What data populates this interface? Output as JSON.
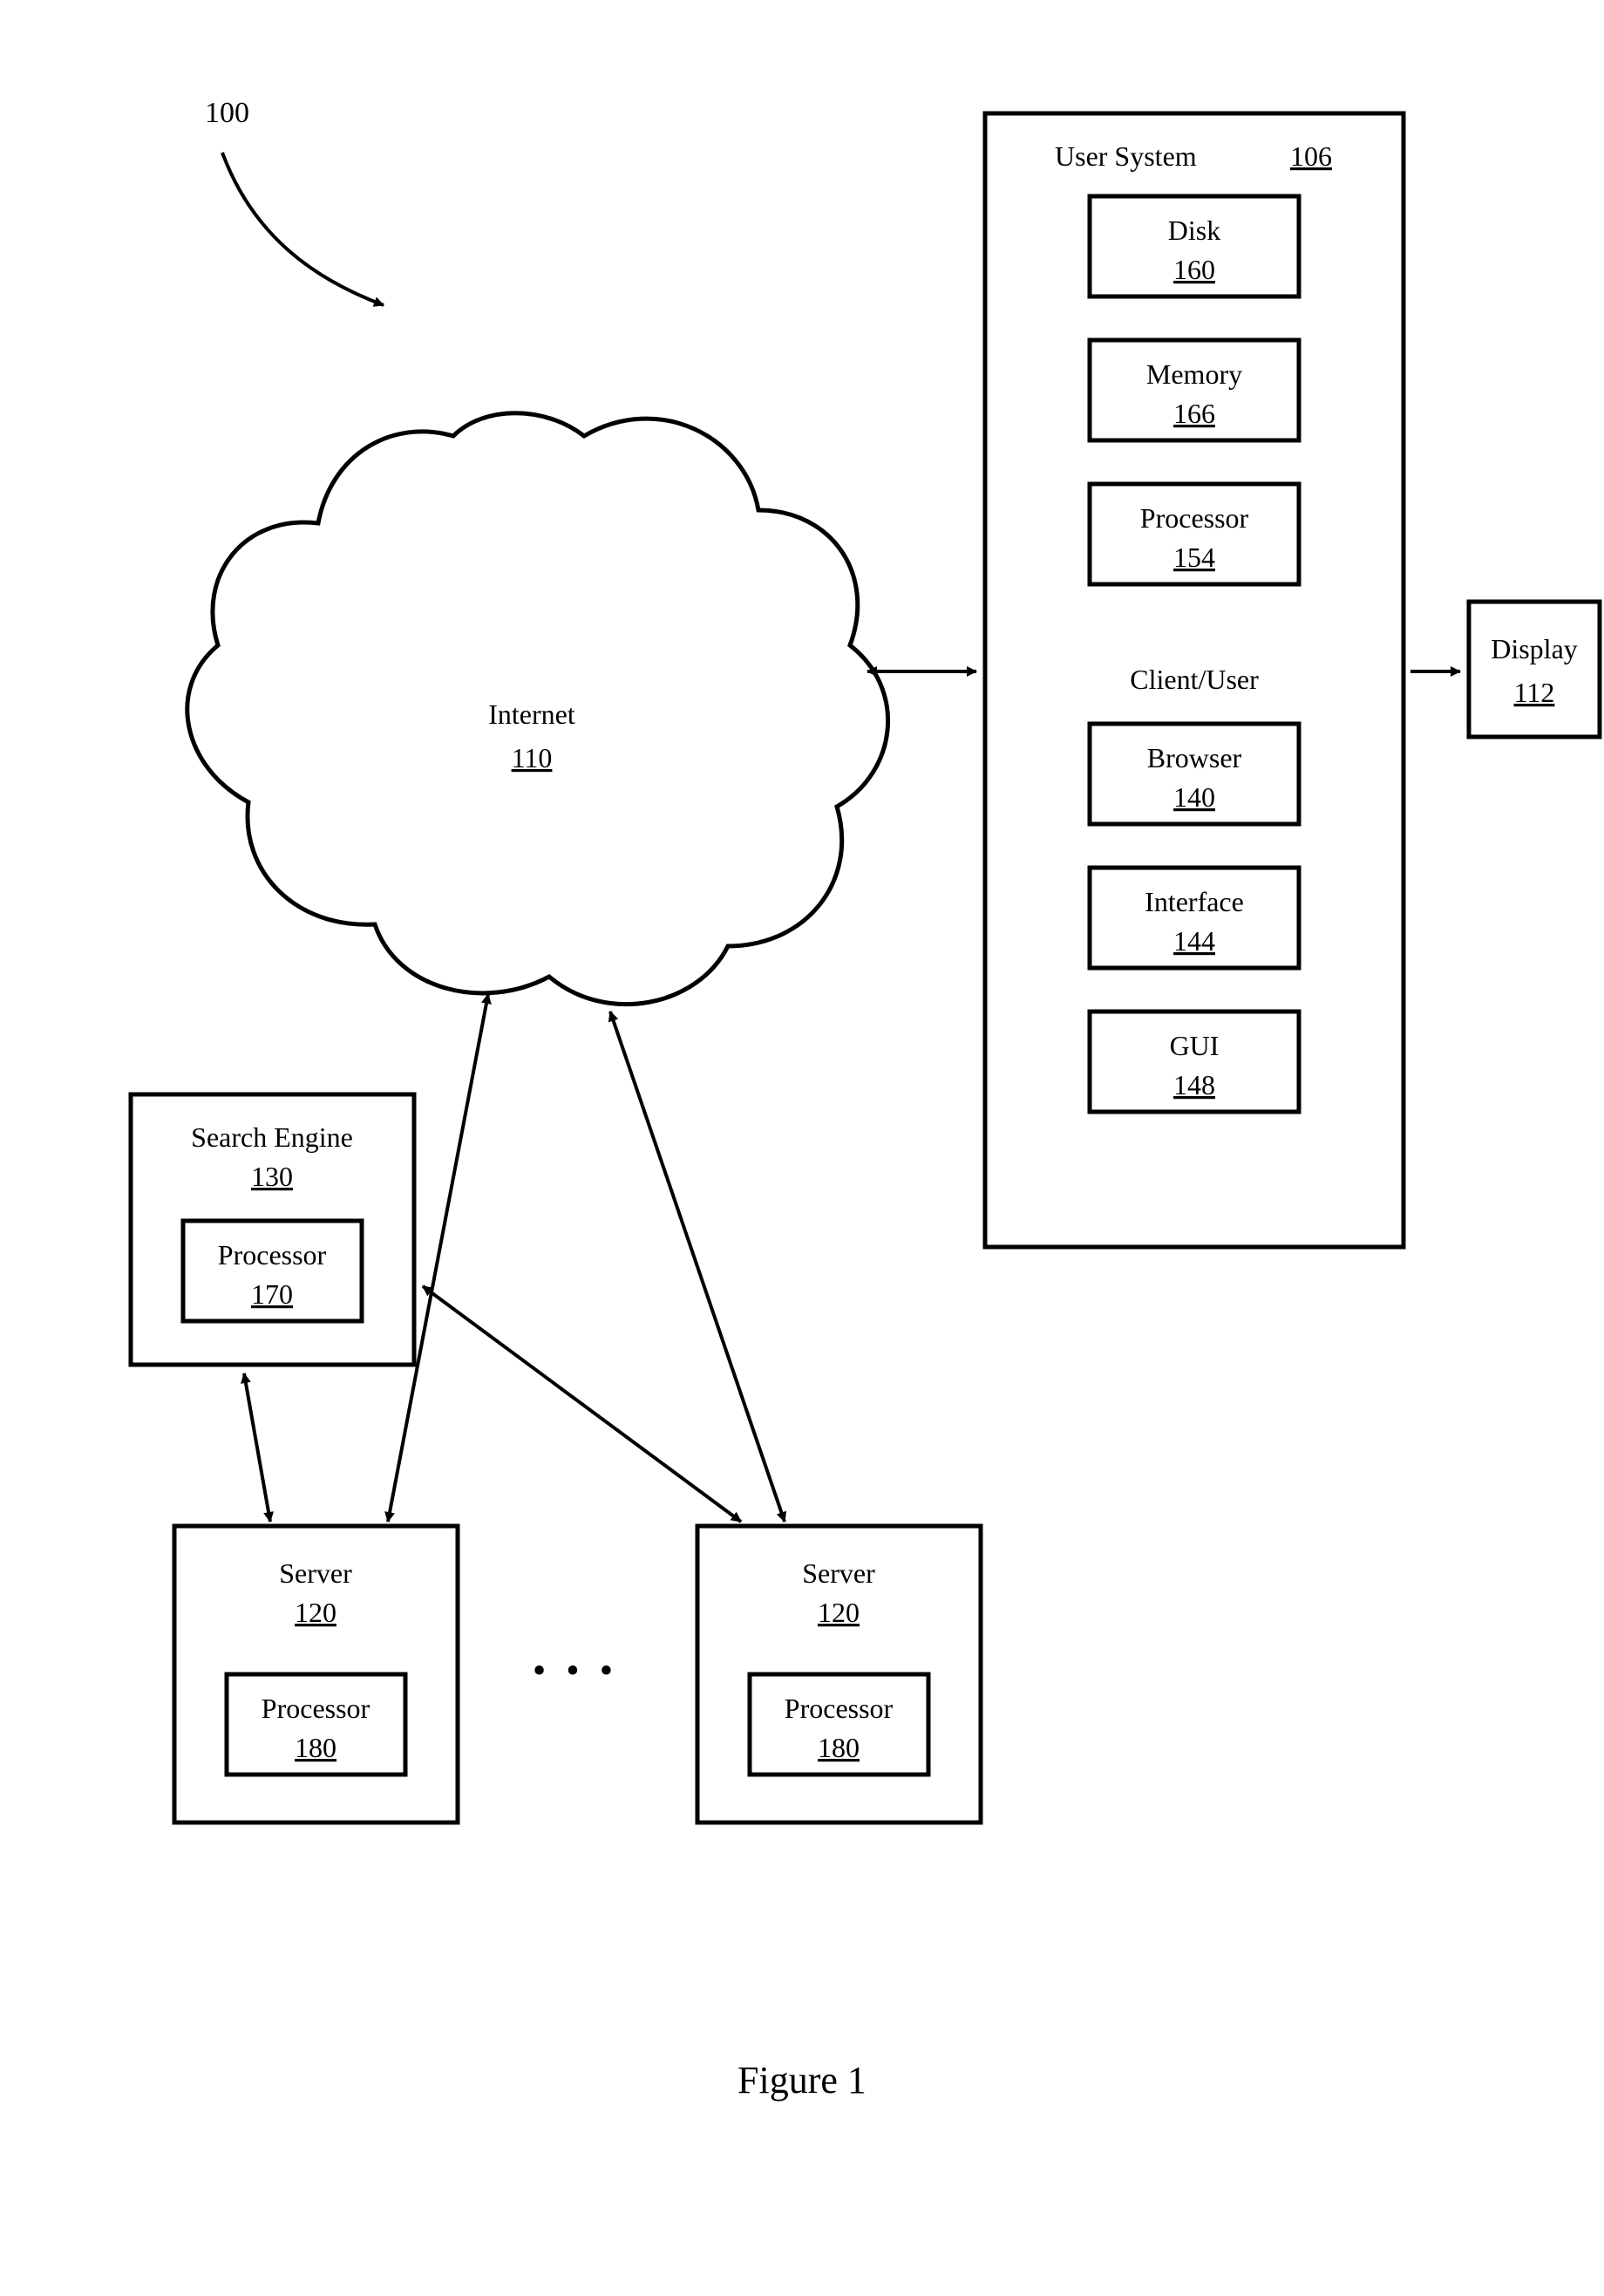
{
  "figure_id": "100",
  "caption": "Figure 1",
  "internet": {
    "label": "Internet",
    "ref": "110"
  },
  "user_system": {
    "title": "User System",
    "ref": "106",
    "blocks": [
      {
        "label": "Disk",
        "ref": "160"
      },
      {
        "label": "Memory",
        "ref": "166"
      },
      {
        "label": "Processor",
        "ref": "154"
      }
    ],
    "subtitle": "Client/User",
    "sub_blocks": [
      {
        "label": "Browser",
        "ref": "140"
      },
      {
        "label": "Interface",
        "ref": "144"
      },
      {
        "label": "GUI",
        "ref": "148"
      }
    ]
  },
  "display": {
    "label": "Display",
    "ref": "112"
  },
  "search_engine": {
    "label": "Search Engine",
    "ref": "130",
    "inner": {
      "label": "Processor",
      "ref": "170"
    }
  },
  "server1": {
    "label": "Server",
    "ref": "120",
    "inner": {
      "label": "Processor",
      "ref": "180"
    }
  },
  "server2": {
    "label": "Server",
    "ref": "120",
    "inner": {
      "label": "Processor",
      "ref": "180"
    }
  },
  "ellipsis": "• • •"
}
